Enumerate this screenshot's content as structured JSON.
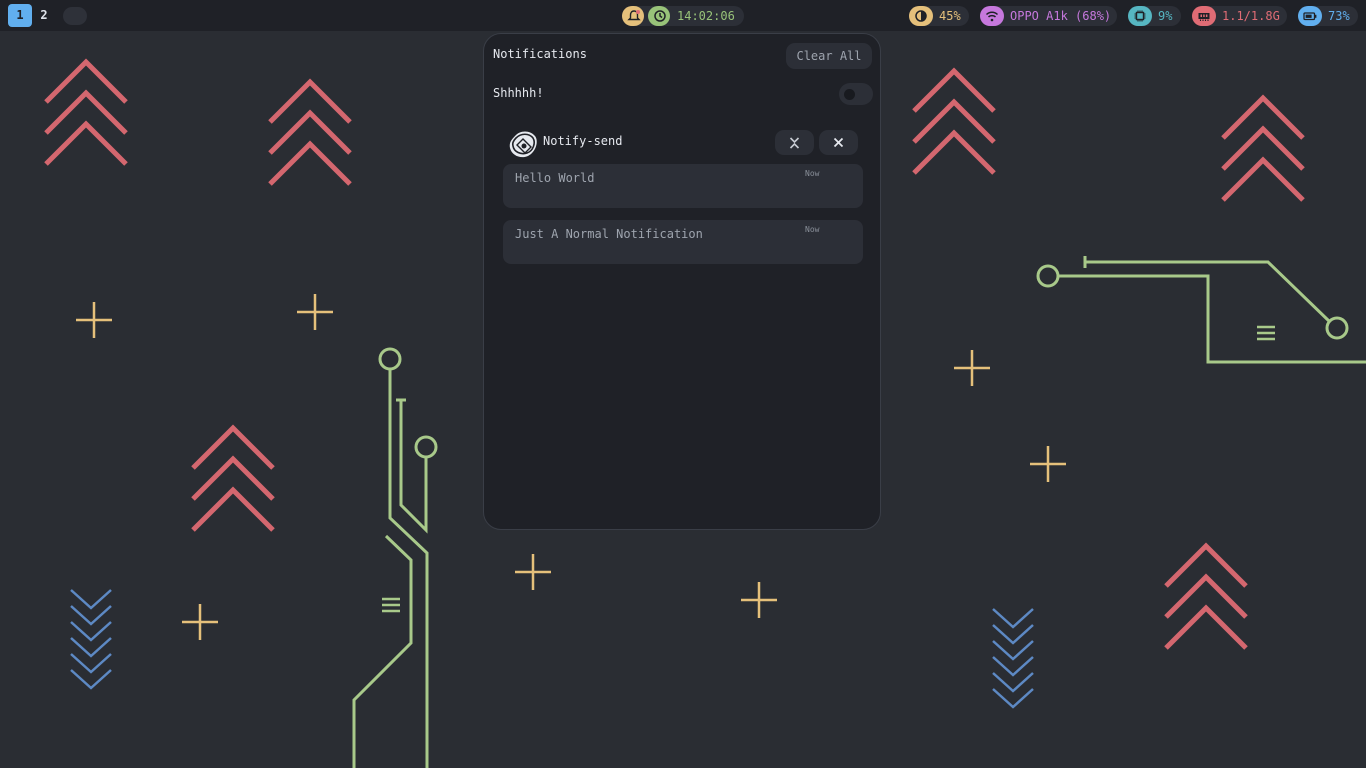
{
  "workspaces": [
    {
      "label": "1",
      "active": true
    },
    {
      "label": "2",
      "active": false
    }
  ],
  "clock": {
    "time": "14:02:06",
    "bell_icon": "bell-alert-icon",
    "clock_icon": "clock-icon"
  },
  "status": {
    "brightness": {
      "value": "45%",
      "icon": "brightness-icon",
      "color": "#e5c07b"
    },
    "wifi": {
      "value": "OPPO A1k (68%)",
      "icon": "wifi-icon",
      "color": "#c678dd"
    },
    "cpu": {
      "value": "9%",
      "icon": "cpu-icon",
      "color": "#56b6c2"
    },
    "memory": {
      "value": "1.1/1.8G",
      "icon": "memory-icon",
      "color": "#e06c75"
    },
    "battery": {
      "value": "73%",
      "icon": "battery-icon",
      "color": "#61afef"
    }
  },
  "notification_center": {
    "title": "Notifications",
    "clear_all": "Clear All",
    "dnd_label": "Shhhhh!",
    "dnd_enabled": false,
    "group": {
      "app_name": "Notify-send",
      "notifications": [
        {
          "body": "Hello World",
          "time": "Now"
        },
        {
          "body": "Just A Normal Notification",
          "time": "Now"
        }
      ]
    }
  },
  "colors": {
    "background": "#2a2d33",
    "bar": "#1f2127",
    "accent_blue": "#61afef",
    "wallpaper_red": "#d4676f",
    "wallpaper_yellow": "#e5c07b",
    "wallpaper_green": "#a8c98a",
    "wallpaper_blue": "#5d89c4"
  }
}
